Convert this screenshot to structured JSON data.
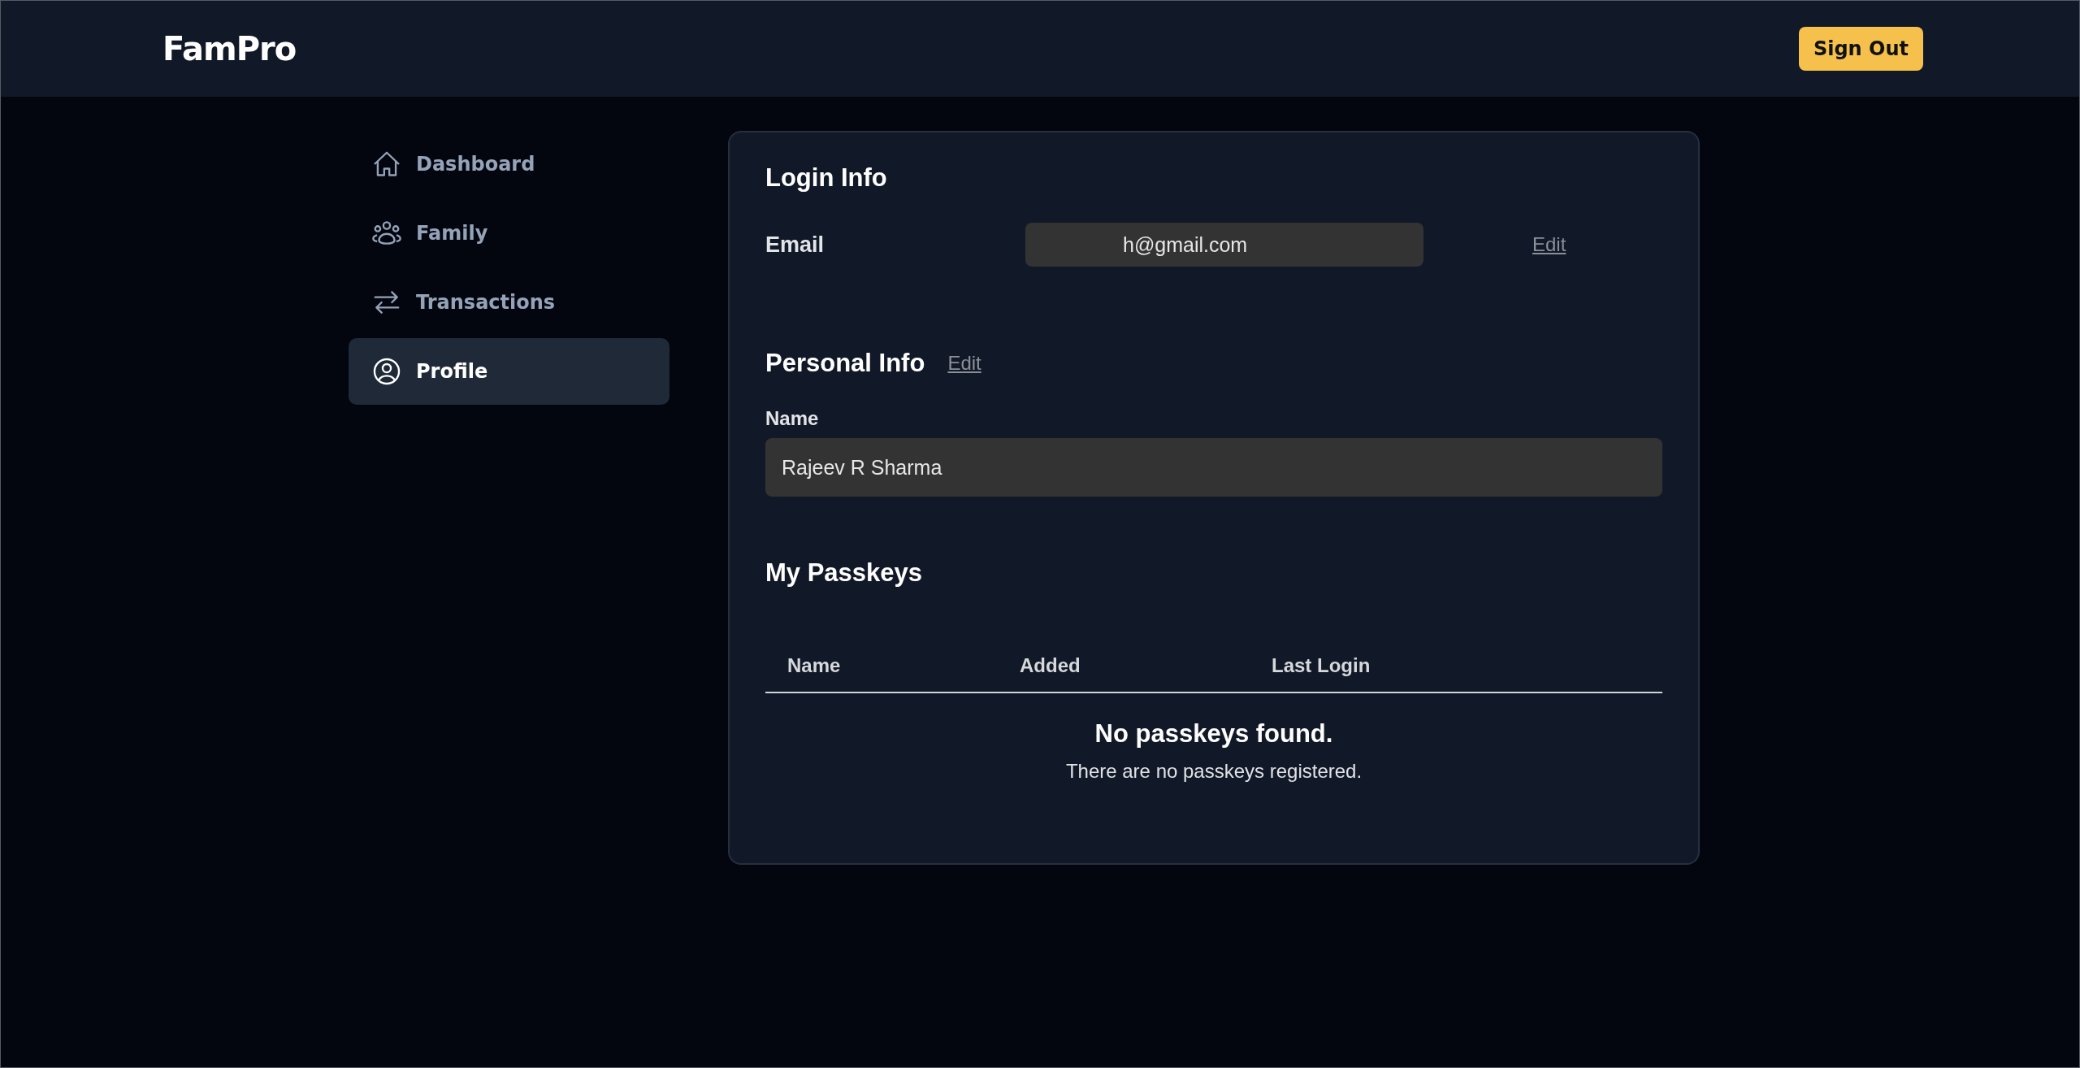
{
  "header": {
    "logo": "FamPro",
    "sign_out": "Sign Out"
  },
  "sidebar": {
    "items": [
      {
        "label": "Dashboard",
        "kind": "home",
        "selected": false
      },
      {
        "label": "Family",
        "kind": "group",
        "selected": false
      },
      {
        "label": "Transactions",
        "kind": "swap",
        "selected": false
      },
      {
        "label": "Profile",
        "kind": "user",
        "selected": true
      }
    ]
  },
  "login_info": {
    "title": "Login Info",
    "email_label": "Email",
    "email_value": "h@gmail.com",
    "edit": "Edit"
  },
  "personal_info": {
    "title": "Personal Info",
    "edit": "Edit",
    "name_label": "Name",
    "name_value": "Rajeev R Sharma"
  },
  "passkeys": {
    "title": "My Passkeys",
    "columns": [
      "Name",
      "Added",
      "Last Login"
    ],
    "empty_title": "No passkeys found.",
    "empty_text": "There are no passkeys registered."
  }
}
